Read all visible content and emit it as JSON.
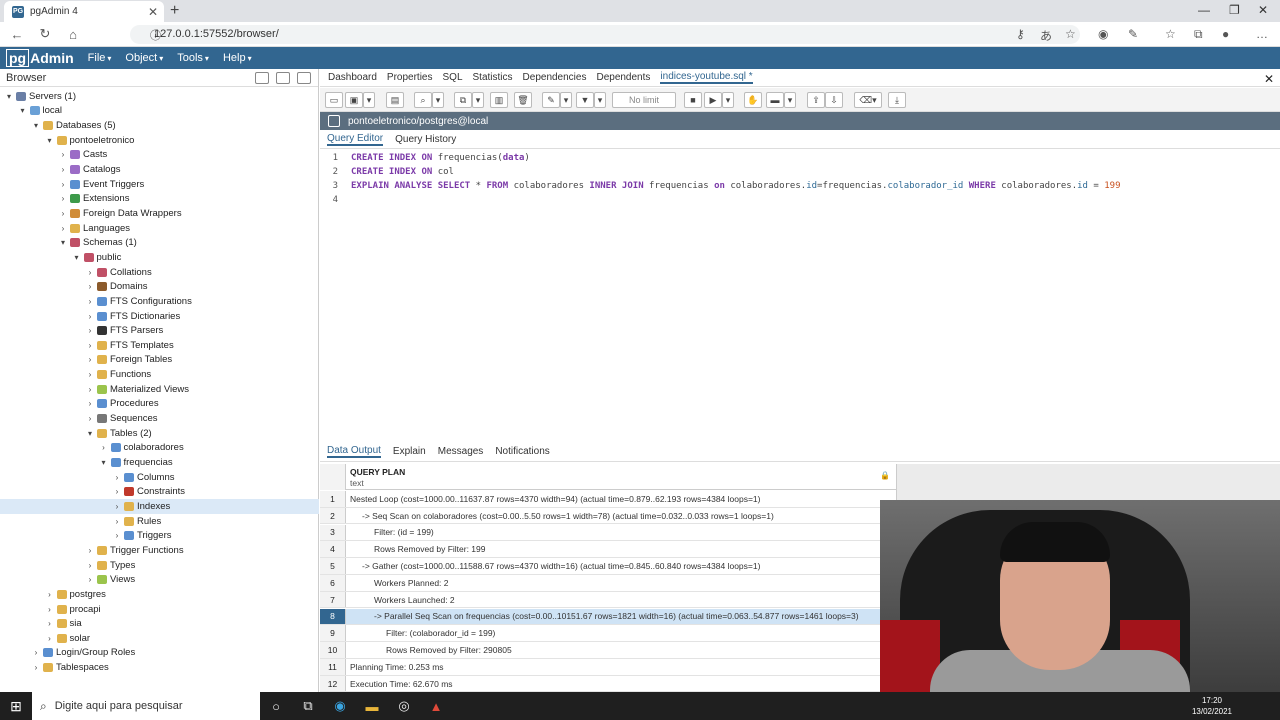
{
  "browser": {
    "tab_title": "pgAdmin 4",
    "favicon_text": "PG",
    "url": "127.0.0.1:57552/browser/"
  },
  "app": {
    "logo_left": "pg",
    "logo_right": "Admin",
    "menus": [
      "File",
      "Object",
      "Tools",
      "Help"
    ]
  },
  "left": {
    "title": "Browser",
    "tree": [
      {
        "label": "Servers (1)",
        "depth": 0,
        "open": true,
        "color": "#6a7fa6"
      },
      {
        "label": "local",
        "depth": 1,
        "open": true,
        "color": "#6aa0d6"
      },
      {
        "label": "Databases (5)",
        "depth": 2,
        "open": true,
        "color": "#e0b24c"
      },
      {
        "label": "pontoeletronico",
        "depth": 3,
        "open": true,
        "color": "#e0b24c"
      },
      {
        "label": "Casts",
        "depth": 4,
        "open": false,
        "color": "#9b6cc6"
      },
      {
        "label": "Catalogs",
        "depth": 4,
        "open": false,
        "color": "#9b6cc6"
      },
      {
        "label": "Event Triggers",
        "depth": 4,
        "open": false,
        "color": "#5a8fd0"
      },
      {
        "label": "Extensions",
        "depth": 4,
        "open": false,
        "color": "#3d9a4a"
      },
      {
        "label": "Foreign Data Wrappers",
        "depth": 4,
        "open": false,
        "color": "#d08c38"
      },
      {
        "label": "Languages",
        "depth": 4,
        "open": false,
        "color": "#e0b24c"
      },
      {
        "label": "Schemas (1)",
        "depth": 4,
        "open": true,
        "color": "#c05066"
      },
      {
        "label": "public",
        "depth": 5,
        "open": true,
        "color": "#c05066"
      },
      {
        "label": "Collations",
        "depth": 6,
        "open": false,
        "color": "#c05066"
      },
      {
        "label": "Domains",
        "depth": 6,
        "open": false,
        "color": "#8b5a2b"
      },
      {
        "label": "FTS Configurations",
        "depth": 6,
        "open": false,
        "color": "#5a8fd0"
      },
      {
        "label": "FTS Dictionaries",
        "depth": 6,
        "open": false,
        "color": "#5a8fd0"
      },
      {
        "label": "FTS Parsers",
        "depth": 6,
        "open": false,
        "color": "#333333"
      },
      {
        "label": "FTS Templates",
        "depth": 6,
        "open": false,
        "color": "#e0b24c"
      },
      {
        "label": "Foreign Tables",
        "depth": 6,
        "open": false,
        "color": "#e0b24c"
      },
      {
        "label": "Functions",
        "depth": 6,
        "open": false,
        "color": "#e0b24c"
      },
      {
        "label": "Materialized Views",
        "depth": 6,
        "open": false,
        "color": "#9bc44c"
      },
      {
        "label": "Procedures",
        "depth": 6,
        "open": false,
        "color": "#5a8fd0"
      },
      {
        "label": "Sequences",
        "depth": 6,
        "open": false,
        "color": "#777777"
      },
      {
        "label": "Tables (2)",
        "depth": 6,
        "open": true,
        "color": "#e0b24c"
      },
      {
        "label": "colaboradores",
        "depth": 7,
        "open": false,
        "color": "#5a8fd0"
      },
      {
        "label": "frequencias",
        "depth": 7,
        "open": true,
        "color": "#5a8fd0"
      },
      {
        "label": "Columns",
        "depth": 8,
        "open": false,
        "color": "#5a8fd0"
      },
      {
        "label": "Constraints",
        "depth": 8,
        "open": false,
        "color": "#c0392b"
      },
      {
        "label": "Indexes",
        "depth": 8,
        "open": false,
        "color": "#e0b24c",
        "selected": true
      },
      {
        "label": "Rules",
        "depth": 8,
        "open": false,
        "color": "#e0b24c"
      },
      {
        "label": "Triggers",
        "depth": 8,
        "open": false,
        "color": "#5a8fd0"
      },
      {
        "label": "Trigger Functions",
        "depth": 6,
        "open": false,
        "color": "#e0b24c"
      },
      {
        "label": "Types",
        "depth": 6,
        "open": false,
        "color": "#e0b24c"
      },
      {
        "label": "Views",
        "depth": 6,
        "open": false,
        "color": "#9bc44c"
      },
      {
        "label": "postgres",
        "depth": 3,
        "open": false,
        "color": "#e0b24c"
      },
      {
        "label": "procapi",
        "depth": 3,
        "open": false,
        "color": "#e0b24c"
      },
      {
        "label": "sia",
        "depth": 3,
        "open": false,
        "color": "#e0b24c"
      },
      {
        "label": "solar",
        "depth": 3,
        "open": false,
        "color": "#e0b24c"
      },
      {
        "label": "Login/Group Roles",
        "depth": 2,
        "open": false,
        "color": "#5a8fd0"
      },
      {
        "label": "Tablespaces",
        "depth": 2,
        "open": false,
        "color": "#e0b24c"
      }
    ]
  },
  "right": {
    "tabs": [
      "Dashboard",
      "Properties",
      "SQL",
      "Statistics",
      "Dependencies",
      "Dependents",
      "indices-youtube.sql *"
    ],
    "active_tab": "indices-youtube.sql *",
    "toolbar": {
      "limit": "No limit"
    },
    "connection": "pontoeletronico/postgres@local",
    "query_tabs": [
      "Query Editor",
      "Query History"
    ],
    "editor_lines": [
      {
        "num": "1",
        "tokens": [
          {
            "t": "CREATE INDEX ON ",
            "c": "kw"
          },
          {
            "t": "frequencias(",
            "c": "id"
          },
          {
            "t": "data",
            "c": "kw"
          },
          {
            "t": ")",
            "c": "id"
          }
        ]
      },
      {
        "num": "2",
        "tokens": [
          {
            "t": "CREATE INDEX ON ",
            "c": "kw"
          },
          {
            "t": "col",
            "c": "id"
          }
        ]
      },
      {
        "num": "3",
        "tokens": [
          {
            "t": "EXPLAIN ANALYSE SELECT ",
            "c": "kw"
          },
          {
            "t": "* ",
            "c": "id"
          },
          {
            "t": "FROM ",
            "c": "kw"
          },
          {
            "t": "colaboradores ",
            "c": "id"
          },
          {
            "t": "INNER JOIN ",
            "c": "kw"
          },
          {
            "t": "frequencias ",
            "c": "id"
          },
          {
            "t": "on ",
            "c": "kw"
          },
          {
            "t": "colaboradores.",
            "c": "id"
          },
          {
            "t": "id",
            "c": "fn"
          },
          {
            "t": "=frequencias.",
            "c": "id"
          },
          {
            "t": "colaborador_id ",
            "c": "fn"
          },
          {
            "t": "WHERE ",
            "c": "kw"
          },
          {
            "t": "colaboradores.",
            "c": "id"
          },
          {
            "t": "id ",
            "c": "fn"
          },
          {
            "t": "= ",
            "c": "id"
          },
          {
            "t": "199",
            "c": "num"
          }
        ]
      },
      {
        "num": "4",
        "tokens": []
      }
    ],
    "result_tabs": [
      "Data Output",
      "Explain",
      "Messages",
      "Notifications"
    ],
    "grid": {
      "col_name": "QUERY PLAN",
      "col_type": "text",
      "rows": [
        {
          "n": "1",
          "v": "Nested Loop  (cost=1000.00..11637.87 rows=4370 width=94) (actual time=0.879..62.193 rows=4384 loops=1)",
          "indent": 0
        },
        {
          "n": "2",
          "v": "->  Seq Scan on colaboradores  (cost=0.00..5.50 rows=1 width=78) (actual time=0.032..0.033 rows=1 loops=1)",
          "indent": 1
        },
        {
          "n": "3",
          "v": "Filter: (id = 199)",
          "indent": 2
        },
        {
          "n": "4",
          "v": "Rows Removed by Filter: 199",
          "indent": 2
        },
        {
          "n": "5",
          "v": "->  Gather  (cost=1000.00..11588.67 rows=4370 width=16) (actual time=0.845..60.840 rows=4384 loops=1)",
          "indent": 1
        },
        {
          "n": "6",
          "v": "Workers Planned: 2",
          "indent": 2
        },
        {
          "n": "7",
          "v": "Workers Launched: 2",
          "indent": 2
        },
        {
          "n": "8",
          "v": "->  Parallel Seq Scan on frequencias  (cost=0.00..10151.67 rows=1821 width=16) (actual time=0.063..54.877 rows=1461 loops=3)",
          "indent": 2,
          "selected": true
        },
        {
          "n": "9",
          "v": "Filter: (colaborador_id = 199)",
          "indent": 3
        },
        {
          "n": "10",
          "v": "Rows Removed by Filter: 290805",
          "indent": 3
        },
        {
          "n": "11",
          "v": "Planning Time: 0.253 ms",
          "indent": 0
        },
        {
          "n": "12",
          "v": "Execution Time: 62.670 ms",
          "indent": 0
        }
      ]
    }
  },
  "taskbar": {
    "search_placeholder": "Digite aqui para pesquisar",
    "time": "17:20",
    "date": "13/02/2021"
  }
}
